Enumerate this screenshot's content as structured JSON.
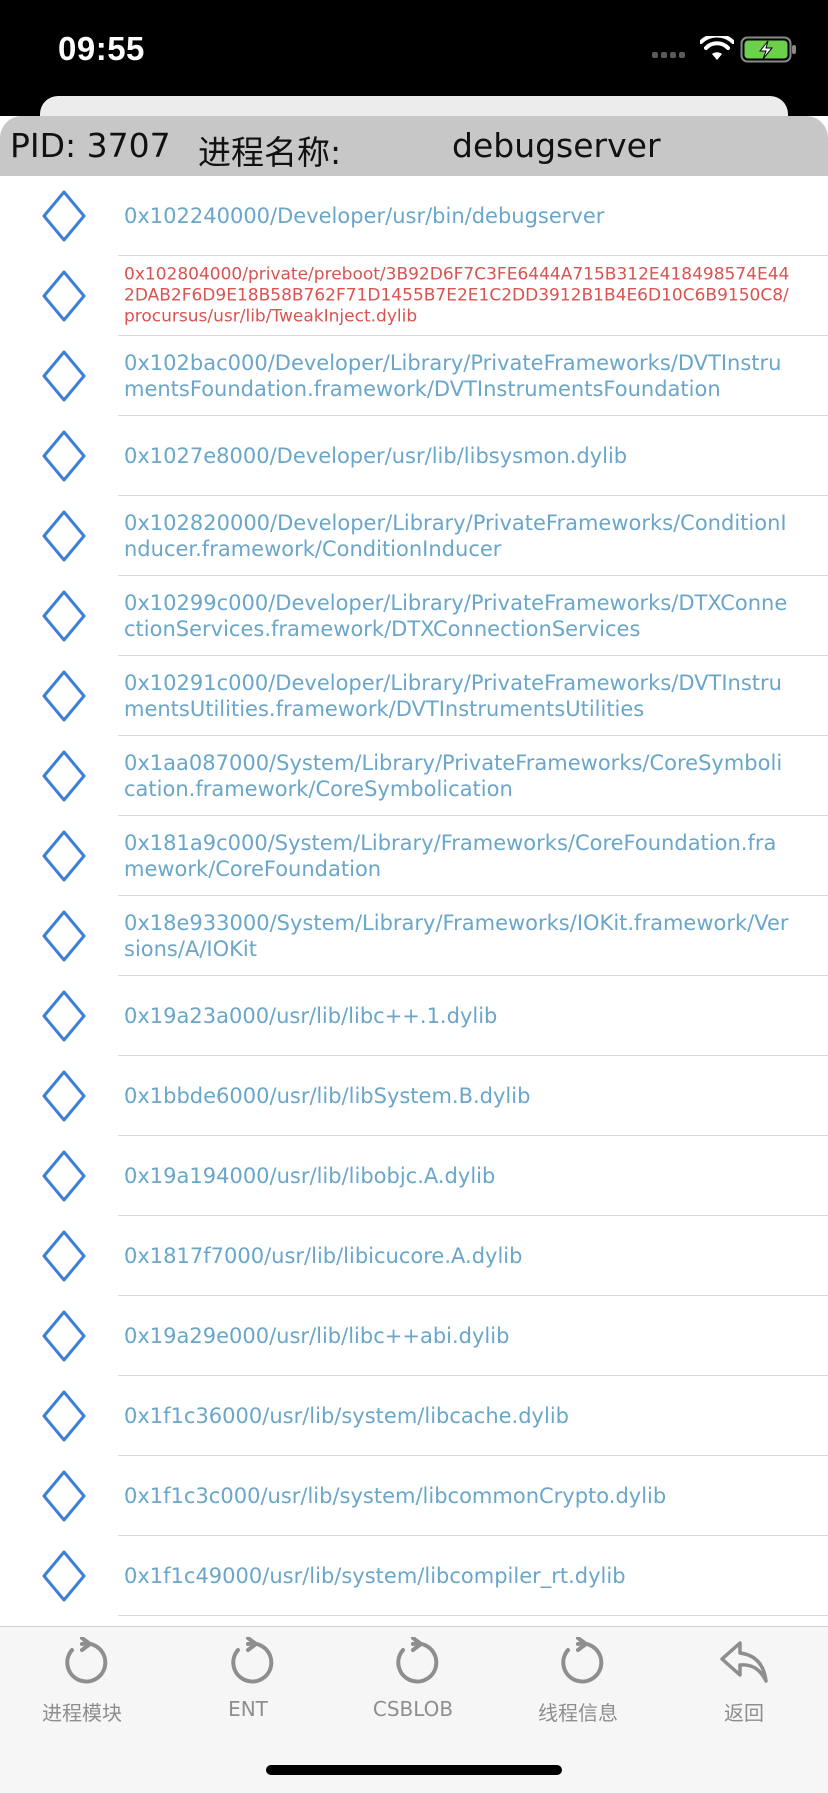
{
  "status_bar": {
    "time": "09:55",
    "icons": [
      "signal-icon",
      "wifi-icon",
      "battery-charging-icon"
    ],
    "battery_color": "#6cd04a"
  },
  "header": {
    "pid_label": "PID: 3707",
    "process_name_label": "进程名称:",
    "process_name_value": "debugserver"
  },
  "colors": {
    "link": "#6aa6c9",
    "highlight": "#d9534f",
    "diamond": "#3d7fd6"
  },
  "modules": [
    {
      "path": "0x102240000/Developer/usr/bin/debugserver",
      "highlight": false
    },
    {
      "path": "0x102804000/private/preboot/3B92D6F7C3FE6444A715B312E418498574E442DAB2F6D9E18B58B762F71D1455B7E2E1C2DD3912B1B4E6D10C6B9150C8/procursus/usr/lib/TweakInject.dylib",
      "highlight": true
    },
    {
      "path": "0x102bac000/Developer/Library/PrivateFrameworks/DVTInstrumentsFoundation.framework/DVTInstrumentsFoundation",
      "highlight": false
    },
    {
      "path": "0x1027e8000/Developer/usr/lib/libsysmon.dylib",
      "highlight": false
    },
    {
      "path": "0x102820000/Developer/Library/PrivateFrameworks/ConditionInducer.framework/ConditionInducer",
      "highlight": false
    },
    {
      "path": "0x10299c000/Developer/Library/PrivateFrameworks/DTXConnectionServices.framework/DTXConnectionServices",
      "highlight": false
    },
    {
      "path": "0x10291c000/Developer/Library/PrivateFrameworks/DVTInstrumentsUtilities.framework/DVTInstrumentsUtilities",
      "highlight": false
    },
    {
      "path": "0x1aa087000/System/Library/PrivateFrameworks/CoreSymbolication.framework/CoreSymbolication",
      "highlight": false
    },
    {
      "path": "0x181a9c000/System/Library/Frameworks/CoreFoundation.framework/CoreFoundation",
      "highlight": false
    },
    {
      "path": "0x18e933000/System/Library/Frameworks/IOKit.framework/Versions/A/IOKit",
      "highlight": false
    },
    {
      "path": "0x19a23a000/usr/lib/libc++.1.dylib",
      "highlight": false
    },
    {
      "path": "0x1bbde6000/usr/lib/libSystem.B.dylib",
      "highlight": false
    },
    {
      "path": "0x19a194000/usr/lib/libobjc.A.dylib",
      "highlight": false
    },
    {
      "path": "0x1817f7000/usr/lib/libicucore.A.dylib",
      "highlight": false
    },
    {
      "path": "0x19a29e000/usr/lib/libc++abi.dylib",
      "highlight": false
    },
    {
      "path": "0x1f1c36000/usr/lib/system/libcache.dylib",
      "highlight": false
    },
    {
      "path": "0x1f1c3c000/usr/lib/system/libcommonCrypto.dylib",
      "highlight": false
    },
    {
      "path": "0x1f1c49000/usr/lib/system/libcompiler_rt.dylib",
      "highlight": false
    }
  ],
  "tabbar": {
    "tabs": [
      {
        "label": "进程模块",
        "icon": "refresh-icon"
      },
      {
        "label": "ENT",
        "icon": "refresh-icon"
      },
      {
        "label": "CSBLOB",
        "icon": "refresh-icon"
      },
      {
        "label": "线程信息",
        "icon": "refresh-icon"
      },
      {
        "label": "返回",
        "icon": "reply-back-icon"
      }
    ]
  }
}
